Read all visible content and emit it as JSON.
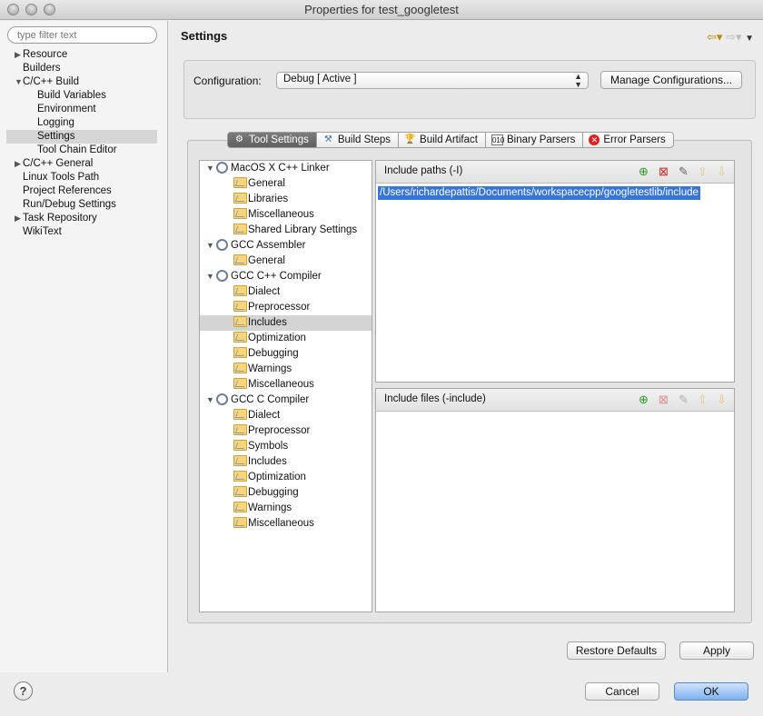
{
  "window": {
    "title": "Properties for test_googletest"
  },
  "filter": {
    "placeholder": "type filter text"
  },
  "nav": {
    "items": [
      {
        "label": "Resource",
        "expandable": true,
        "expanded": false,
        "level": 0
      },
      {
        "label": "Builders",
        "level": 0
      },
      {
        "label": "C/C++ Build",
        "expandable": true,
        "expanded": true,
        "level": 0
      },
      {
        "label": "Build Variables",
        "level": 1
      },
      {
        "label": "Environment",
        "level": 1
      },
      {
        "label": "Logging",
        "level": 1
      },
      {
        "label": "Settings",
        "level": 1,
        "selected": true
      },
      {
        "label": "Tool Chain Editor",
        "level": 1
      },
      {
        "label": "C/C++ General",
        "expandable": true,
        "expanded": false,
        "level": 0
      },
      {
        "label": "Linux Tools Path",
        "level": 0
      },
      {
        "label": "Project References",
        "level": 0
      },
      {
        "label": "Run/Debug Settings",
        "level": 0
      },
      {
        "label": "Task Repository",
        "expandable": true,
        "expanded": false,
        "level": 0
      },
      {
        "label": "WikiText",
        "level": 0
      }
    ]
  },
  "header": {
    "title": "Settings"
  },
  "config": {
    "label": "Configuration:",
    "value": "Debug  [ Active ]",
    "manage_label": "Manage Configurations..."
  },
  "tabs": [
    {
      "label": "Tool Settings",
      "active": true,
      "icon": "tool-settings-icon"
    },
    {
      "label": "Build Steps",
      "icon": "build-steps-icon"
    },
    {
      "label": "Build Artifact",
      "icon": "trophy-icon"
    },
    {
      "label": "Binary Parsers",
      "icon": "binary-icon"
    },
    {
      "label": "Error Parsers",
      "icon": "error-icon"
    }
  ],
  "tree": [
    {
      "label": "MacOS X C++ Linker",
      "type": "tool",
      "children": [
        "General",
        "Libraries",
        "Miscellaneous",
        "Shared Library Settings"
      ]
    },
    {
      "label": "GCC Assembler",
      "type": "tool",
      "children": [
        "General"
      ]
    },
    {
      "label": "GCC C++ Compiler",
      "type": "tool",
      "children": [
        "Dialect",
        "Preprocessor",
        "Includes",
        "Optimization",
        "Debugging",
        "Warnings",
        "Miscellaneous"
      ]
    },
    {
      "label": "GCC C Compiler",
      "type": "tool",
      "children": [
        "Dialect",
        "Preprocessor",
        "Symbols",
        "Includes",
        "Optimization",
        "Debugging",
        "Warnings",
        "Miscellaneous"
      ]
    }
  ],
  "selected_tree_item": "GCC C++ Compiler / Includes",
  "include_paths": {
    "label": "Include paths (-I)",
    "items": [
      "/Users/richardepattis/Documents/workspacecpp/googletestlib/include"
    ]
  },
  "include_files": {
    "label": "Include files (-include)",
    "items": []
  },
  "buttons": {
    "restore": "Restore Defaults",
    "apply": "Apply",
    "cancel": "Cancel",
    "ok": "OK",
    "help": "?"
  },
  "colors": {
    "selection": "#3875d7",
    "ok_accent": "#7fb1ee"
  }
}
